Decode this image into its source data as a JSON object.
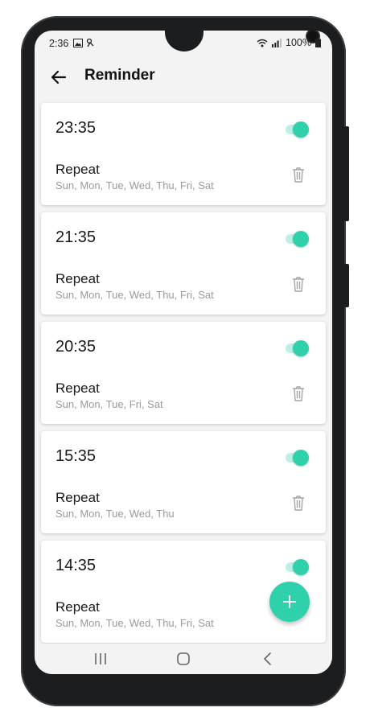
{
  "status": {
    "time": "2:36",
    "battery": "100%"
  },
  "header": {
    "title": "Reminder"
  },
  "reminders": [
    {
      "time": "23:35",
      "repeat_label": "Repeat",
      "days": "Sun, Mon, Tue, Wed, Thu, Fri, Sat",
      "enabled": true
    },
    {
      "time": "21:35",
      "repeat_label": "Repeat",
      "days": "Sun, Mon, Tue, Wed, Thu, Fri, Sat",
      "enabled": true
    },
    {
      "time": "20:35",
      "repeat_label": "Repeat",
      "days": "Sun, Mon, Tue, Fri, Sat",
      "enabled": true
    },
    {
      "time": "15:35",
      "repeat_label": "Repeat",
      "days": "Sun, Mon, Tue, Wed, Thu",
      "enabled": true
    },
    {
      "time": "14:35",
      "repeat_label": "Repeat",
      "days": "Sun, Mon, Tue, Wed, Thu, Fri, Sat",
      "enabled": true
    }
  ],
  "fab": {
    "icon": "plus-icon"
  },
  "colors": {
    "accent": "#2fd1ad",
    "accent_track": "#bfeee2",
    "background": "#f3f3f3"
  },
  "navbar": {
    "icons": [
      "recent-apps-icon",
      "home-icon",
      "back-nav-icon"
    ]
  }
}
